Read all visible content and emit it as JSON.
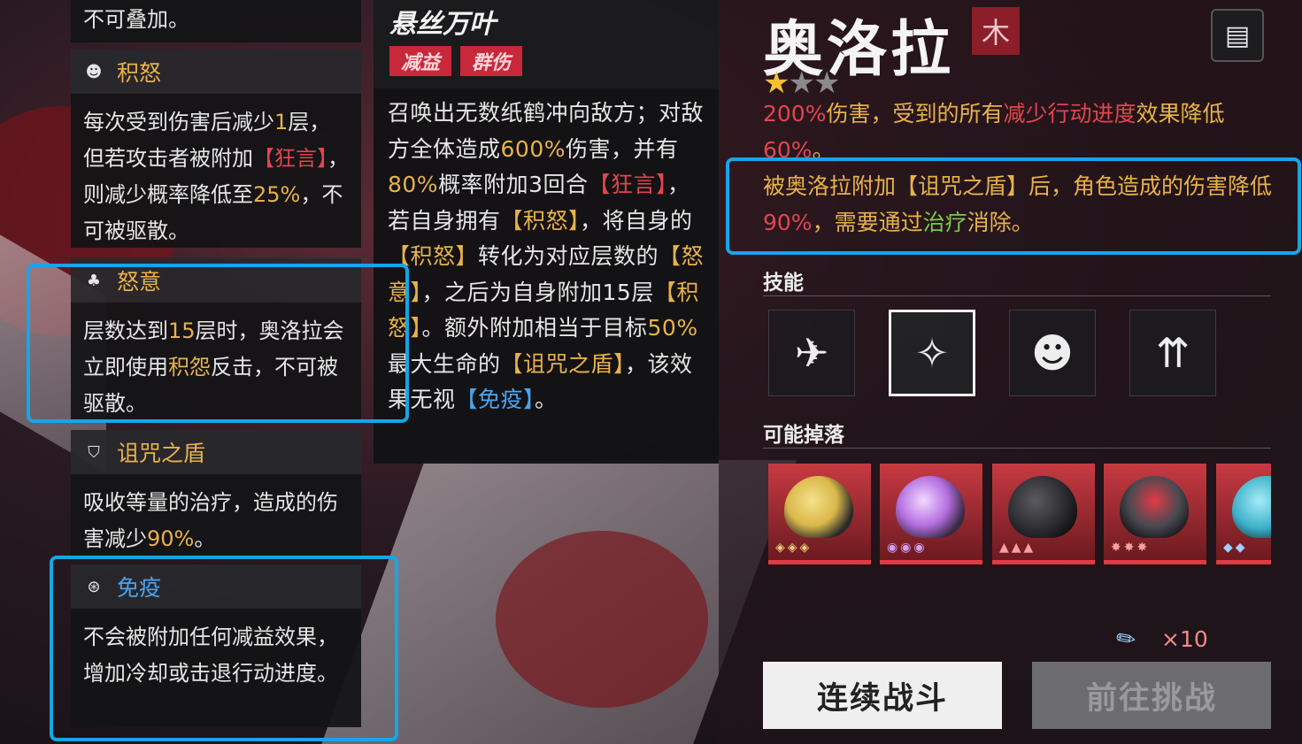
{
  "effects": {
    "top_fragment": "不可叠加。",
    "accumulated_rage": {
      "title": "积怒",
      "text_parts": [
        "每次受到伤害后减少",
        "1",
        "层，但若攻击者被附加",
        "【狂言】",
        "，则减少概率降低至",
        "25%",
        "，不可被驱散。"
      ]
    },
    "fury": {
      "title": "怒意",
      "text_parts": [
        "层数达到",
        "15",
        "层时，奥洛拉会立即使用",
        "积怨",
        "反击，不可被驱散。"
      ]
    },
    "curse_shield": {
      "title": "诅咒之盾",
      "text_parts": [
        "吸收等量的治疗，造成的伤害减少",
        "90%",
        "。"
      ]
    },
    "immunity": {
      "title": "免疫",
      "text": "不会被附加任何减益效果，增加冷却或击退行动进度。"
    }
  },
  "skill": {
    "name": "悬丝万叶",
    "tags": [
      "减益",
      "群伤"
    ],
    "text_parts": [
      "召唤出无数纸鹤冲向敌方；对敌方全体造成",
      "600%",
      "伤害，并有",
      "80%",
      "概率附加3回合",
      "【狂言】",
      "，若自身拥有",
      "【积怒】",
      "，将自身的",
      "【积怒】",
      "转化为对应层数的",
      "【怒意】",
      "，之后为自身附加15层",
      "【积怒】",
      "。额外附加相当于目标",
      "50%",
      "最大生命的",
      "【诅咒之盾】",
      "，该效果无视",
      "【免疫】",
      "。"
    ]
  },
  "boss": {
    "name": "奥洛拉",
    "class_icon": "class-emblem-icon",
    "stars_filled": 1,
    "stars_total": 3,
    "desc_parts": [
      "200%",
      "伤害，受到的所有",
      "减少行动进度",
      "效果降低",
      "60%",
      "。"
    ],
    "desc2_parts": [
      "被奥洛拉附加",
      "【诅咒之盾】",
      "后，角色造成的伤害降低",
      "90%",
      "，需要通过",
      "治疗",
      "消除。"
    ]
  },
  "sections": {
    "skills_label": "技能",
    "drops_label": "可能掉落"
  },
  "skill_icons": [
    "paper-crane-icon",
    "crane-flight-icon",
    "mask-icon",
    "buildings-buff-icon"
  ],
  "drops": [
    {
      "name": "gold-sphere-gear",
      "color": "#d9b84a",
      "marks": "◈◈◈"
    },
    {
      "name": "purple-sphere-gear",
      "color": "#b46ee0",
      "marks": "◉◉◉"
    },
    {
      "name": "black-helmet-gear",
      "color": "#2a2a2e",
      "marks": "▲▲▲"
    },
    {
      "name": "red-horn-helmet-gear",
      "color": "#4a4a52",
      "marks": "✸✸✸"
    },
    {
      "name": "cyan-visor-gear",
      "color": "#3ab0c8",
      "marks": "◆◆"
    }
  ],
  "stamina": {
    "icon": "ticket-icon",
    "count": "×10"
  },
  "buttons": {
    "continue_battle": "连续战斗",
    "go_challenge": "前往挑战"
  },
  "colors": {
    "highlight_yellow": "#e8b24a",
    "highlight_red": "#e2454f",
    "highlight_blue": "#4aa4ef",
    "highlight_green": "#7bc94a",
    "annotation_box": "#16a6e8"
  }
}
